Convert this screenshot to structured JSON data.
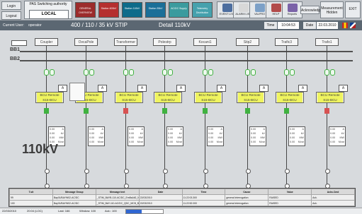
{
  "toolbar": {
    "login": "Login",
    "logout": "Logout",
    "authority_title": "PAS Switching authority",
    "authority_value": "LOCAL",
    "modes": [
      {
        "label": "GENERAL OVERVIEW",
        "color": "#9c2c2c"
      },
      {
        "label": "Station 400kV",
        "color": "#b52f2f"
      },
      {
        "label": "Station 110kV",
        "color": "#0d6b8a"
      },
      {
        "label": "Station 35kV",
        "color": "#1b6f98"
      },
      {
        "label": "AC/DC Supply",
        "color": "#3b9b9e"
      },
      {
        "label": "Telemetry Distribution",
        "color": "#45a1ad"
      }
    ],
    "tools": [
      {
        "label": "EVENT LIST",
        "icon": "event-list-icon"
      },
      {
        "label": "ALARM LIST",
        "icon": "alarm-list-icon"
      },
      {
        "label": "VALPRO",
        "icon": "valpro-icon"
      },
      {
        "label": "HELP",
        "icon": "help-icon"
      },
      {
        "label": "Reports",
        "icon": "reports-icon"
      }
    ],
    "acknowledge": "Acknowledge",
    "measurement_hidden": "Measurement Hidden",
    "exit": "EXIT"
  },
  "header2": {
    "current_user_label": "Current User:",
    "current_user": "operator",
    "title": "400 / 110 / 35 kV  STIP",
    "detail": "Detail 110kV",
    "time_label": "Time",
    "time_value": "10:04:53",
    "date_label": "Date",
    "date_value": "22.03.2010"
  },
  "workspace": {
    "bb1": "BB1",
    "bb2": "BB2",
    "bays": [
      "Coupler",
      "OvcaPole",
      "Transformer",
      "Polestrp",
      "Kocani1",
      "Stip2",
      "Trafic3",
      "Trafo1"
    ],
    "bcu_label_1": "BCU Remote",
    "bcu_label_2": "S15-BCU",
    "a_label": "A",
    "big_label": "110kV"
  },
  "alarm_table": {
    "headers": [
      "T.sit",
      "Message Group",
      "Message text",
      "Date",
      "Time",
      "Cause",
      "Value",
      "Acks.Cmd"
    ],
    "rows": [
      [
        "99",
        "Bay01/BAYW02-AC/DC",
        "_STIM_BAYB-110-AC/DC_EmBsAlt2_Namen",
        "22/03/2010",
        "11:22:03.300",
        "general interrogation",
        "RAISED",
        "Ack."
      ],
      [
        "100",
        "Bay01/BAYW02-AC/DC",
        "_STIM_BAY-110-AC/DC_QDC_MCB_BusCoupler_OFF",
        "22/03/2010",
        "11:22:52.000",
        "general interrogation",
        "RAISED",
        "Ack."
      ]
    ]
  },
  "status": {
    "date_text": "22/03/2010",
    "time_text": "20:04 (LOC)",
    "last": "Last: 166",
    "window": "Window: 100",
    "ack": "Ack:: 100",
    "progress": 0.42
  }
}
